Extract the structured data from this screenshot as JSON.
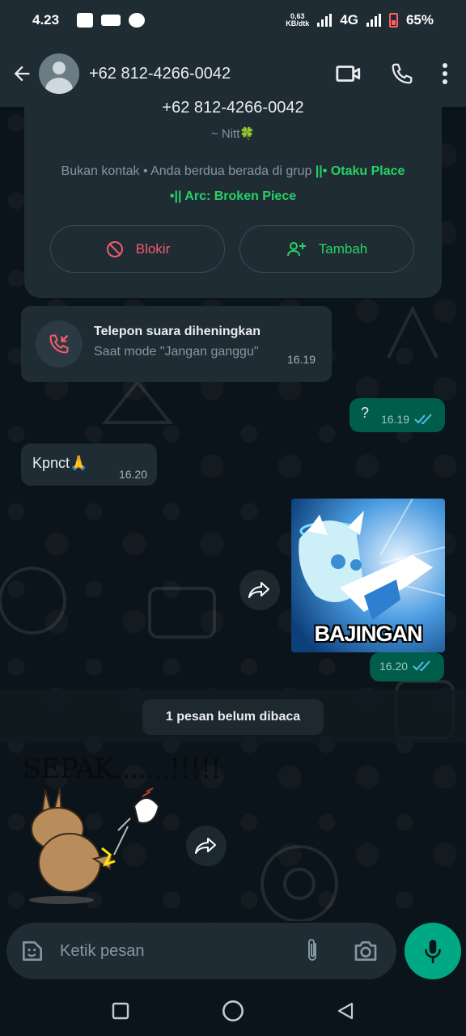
{
  "status_bar": {
    "time": "4.23",
    "net_speed_value": "0,63",
    "net_speed_unit": "KB/dtk",
    "network": "4G",
    "battery": "65%"
  },
  "header": {
    "contact": "+62 812-4266-0042"
  },
  "info_card": {
    "phone": "+62 812-4266-0042",
    "about": "~ Nitt🍀",
    "note_prefix": "Bukan kontak • Anda berdua berada di grup ",
    "group_name": "||• Otaku Place •|| Arc: Broken Piece",
    "block_label": "Blokir",
    "add_label": "Tambah"
  },
  "messages": {
    "call": {
      "title": "Telepon suara diheningkan",
      "subtitle": "Saat mode \"Jangan ganggu\"",
      "time": "16.19"
    },
    "question": {
      "text": "?",
      "time": "16.19"
    },
    "kpnct": {
      "text": "Kpnct🙏",
      "time": "16.20"
    },
    "image": {
      "caption": "BAJINGAN",
      "time": "16.20"
    },
    "unread": "1 pesan belum dibaca",
    "sticker_text": "SEPAK.......!!!!!"
  },
  "composer": {
    "placeholder": "Ketik pesan"
  },
  "colors": {
    "accent": "#25d366",
    "outgoing_bubble": "#005c4b",
    "incoming_bubble": "#1f2c34",
    "danger": "#f15c6d",
    "read_ticks": "#53bdeb"
  }
}
